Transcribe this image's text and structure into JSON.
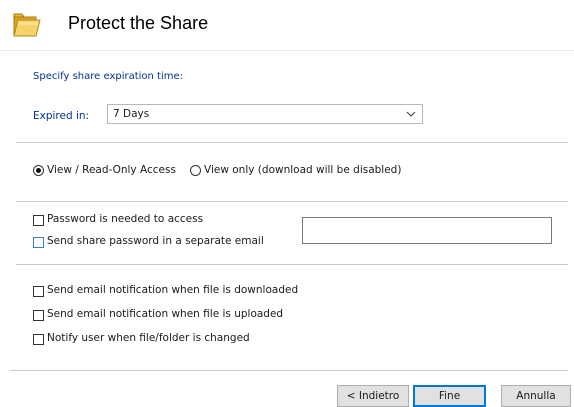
{
  "header": {
    "title": "Protect the Share",
    "icon": "folder-icon"
  },
  "expiration": {
    "section_label": "Specify share expiration time:",
    "label": "Expired in:",
    "selected": "7 Days"
  },
  "access": {
    "options": [
      {
        "label": "View / Read-Only Access",
        "checked": true
      },
      {
        "label": "View only (download will be disabled)",
        "checked": false
      }
    ]
  },
  "password": {
    "required_label": "Password is needed to access",
    "send_separate_label": "Send share password in a separate email",
    "value": ""
  },
  "notifications": {
    "on_download": "Send email notification when file is downloaded",
    "on_upload": "Send email notification when file is uploaded",
    "on_change": "Notify user when file/folder is changed"
  },
  "buttons": {
    "back": "< Indietro",
    "finish": "Fine",
    "cancel": "Annulla"
  },
  "colors": {
    "accent": "#003399",
    "focus": "#0078d7"
  }
}
